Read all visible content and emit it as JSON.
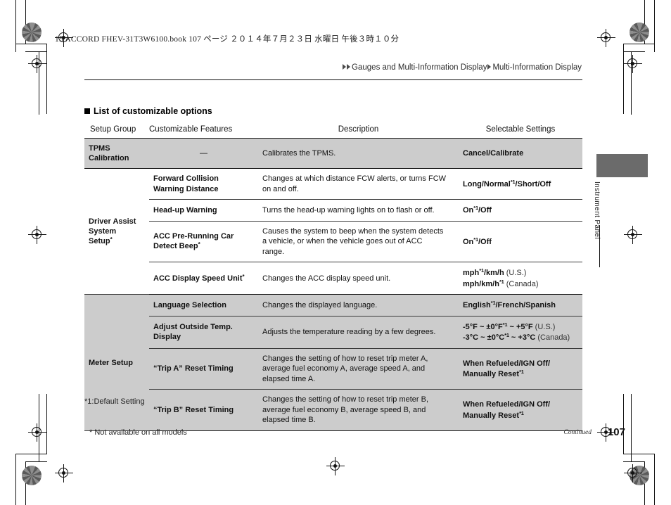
{
  "print_slug": "15 ACCORD FHEV-31T3W6100.book   107 ページ   ２０１４年７月２３日   水曜日   午後３時１０分",
  "breadcrumb": {
    "segment1": "Gauges and Multi-Information Display",
    "segment2": "Multi-Information Display"
  },
  "section": {
    "heading": "List of customizable options"
  },
  "table": {
    "headers": {
      "setup_group": "Setup Group",
      "customizable_features": "Customizable Features",
      "description": "Description",
      "selectable_settings": "Selectable Settings"
    },
    "rows": [
      {
        "group": "TPMS\nCalibration",
        "feature": "—",
        "description": "Calibrates the TPMS.",
        "settings": "Cancel/Calibrate"
      },
      {
        "group": "Driver Assist System Setup",
        "feature": "Forward Collision Warning Distance",
        "description": "Changes at which distance FCW alerts, or turns FCW on and off.",
        "settings": "Long/Normal*1/Short/Off"
      },
      {
        "feature": "Head-up Warning",
        "description": "Turns the head-up warning lights on to flash or off.",
        "settings": "On*1/Off"
      },
      {
        "feature": "ACC Pre-Running Car Detect Beep",
        "description": "Causes the system to beep when the system detects a vehicle, or when the vehicle goes out of ACC range.",
        "settings": "On*1/Off"
      },
      {
        "feature": "ACC Display Speed Unit",
        "description": "Changes the ACC display speed unit.",
        "settings_line1": "mph*1/km/h",
        "settings_region1": "(U.S.)",
        "settings_line2": "mph/km/h*1",
        "settings_region2": "(Canada)"
      },
      {
        "group": "Meter Setup",
        "feature": "Language Selection",
        "description": "Changes the displayed language.",
        "settings": "English*1/French/Spanish"
      },
      {
        "feature": "Adjust Outside Temp. Display",
        "description": "Adjusts the temperature reading by a few degrees.",
        "settings_line1": "-5°F ~ ±0°F*1 ~ +5°F",
        "settings_region1": "(U.S.)",
        "settings_line2": "-3°C ~ ±0°C*1 ~ +3°C",
        "settings_region2": "(Canada)"
      },
      {
        "feature": "“Trip A” Reset Timing",
        "description": "Changes the setting of how to reset trip meter A, average fuel economy A, average speed A, and elapsed time A.",
        "settings": "When Refueled/IGN Off/\nManually Reset*1"
      },
      {
        "feature": "“Trip B” Reset Timing",
        "description": "Changes the setting of how to reset trip meter B, average fuel economy B, average speed B, and elapsed time B.",
        "settings": "When Refueled/IGN Off/\nManually Reset*1"
      }
    ],
    "cells": {
      "r0_group_l1": "TPMS",
      "r0_group_l2": "Calibration",
      "r0_feature": "—",
      "r0_desc": "Calibrates the TPMS.",
      "r0_set": "Cancel/Calibrate",
      "r1_feat_l1": "Forward Collision",
      "r1_feat_l2": "Warning Distance",
      "r1_desc_l1": "Changes at which distance FCW alerts, or turns FCW",
      "r1_desc_l2": "on and off.",
      "r1_set_a": "Long/Normal",
      "r1_set_sup": "*1",
      "r1_set_b": "/Short/Off",
      "grp_driver_l1": "Driver Assist",
      "grp_driver_l2": "System",
      "grp_driver_l3": "Setup",
      "r2_feat": "Head-up Warning",
      "r2_desc": "Turns the head-up warning lights on to flash or off.",
      "r2_set_a": "On",
      "r2_set_sup": "*1",
      "r2_set_b": "/Off",
      "r3_feat_l1": "ACC Pre-Running Car",
      "r3_feat_l2": "Detect Beep",
      "r3_desc_l1": "Causes the system to beep when the system detects",
      "r3_desc_l2": "a vehicle, or when the vehicle goes out of ACC",
      "r3_desc_l3": "range.",
      "r3_set_a": "On",
      "r3_set_sup": "*1",
      "r3_set_b": "/Off",
      "r4_feat": "ACC Display Speed Unit",
      "r4_desc": "Changes the ACC display speed unit.",
      "r4_set_l1a": "mph",
      "r4_set_l1sup": "*1",
      "r4_set_l1b": "/km/h",
      "r4_set_l1reg": " (U.S.)",
      "r4_set_l2a": "mph/km/h",
      "r4_set_l2sup": "*1",
      "r4_set_l2reg": " (Canada)",
      "grp_meter": "Meter Setup",
      "r5_feat": "Language Selection",
      "r5_desc": "Changes the displayed language.",
      "r5_set_a": "English",
      "r5_set_sup": "*1",
      "r5_set_b": "/French/Spanish",
      "r6_feat_l1": "Adjust Outside Temp.",
      "r6_feat_l2": "Display",
      "r6_desc": "Adjusts the temperature reading by a few degrees.",
      "r6_set_l1a": "-5°F ~ ±0°F",
      "r6_set_l1sup": "*1",
      "r6_set_l1b": " ~ +5°F",
      "r6_set_l1reg": " (U.S.)",
      "r6_set_l2a": "-3°C ~ ±0°C",
      "r6_set_l2sup": "*1",
      "r6_set_l2b": " ~ +3°C",
      "r6_set_l2reg": " (Canada)",
      "r7_feat": "“Trip A” Reset Timing",
      "r7_desc_l1": "Changes the setting of how to reset trip meter A,",
      "r7_desc_l2": "average fuel economy A, average speed A, and",
      "r7_desc_l3": "elapsed time A.",
      "r7_set_l1": "When Refueled/IGN Off/",
      "r7_set_l2": "Manually Reset",
      "r7_set_sup": "*1",
      "r8_feat": "“Trip B” Reset Timing",
      "r8_desc_l1": "Changes the setting of how to reset trip meter B,",
      "r8_desc_l2": "average fuel economy B, average speed B, and",
      "r8_desc_l3": "elapsed time B.",
      "r8_set_l1": "When Refueled/IGN Off/",
      "r8_set_l2": "Manually Reset",
      "r8_set_sup": "*1"
    }
  },
  "footnotes": {
    "default_setting": "*1:Default Setting",
    "not_available": "* Not available on all models"
  },
  "footer": {
    "continued": "Continued",
    "page_number": "107"
  },
  "side_tab": {
    "label": "Instrument Panel"
  },
  "colors": {
    "shade": "#cccccc",
    "tab_block": "#6b6b6b",
    "rule": "#111111"
  }
}
